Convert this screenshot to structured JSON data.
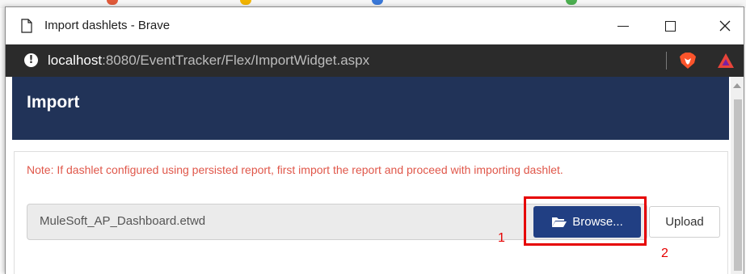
{
  "window": {
    "title": "Import dashlets - Brave"
  },
  "address_bar": {
    "url_host": "localhost",
    "url_rest": ":8080/EventTracker/Flex/ImportWidget.aspx"
  },
  "page": {
    "header_title": "Import",
    "note": "Note: If dashlet configured using persisted report, first import the report and proceed with importing dashlet.",
    "file_name": "MuleSoft_AP_Dashboard.etwd",
    "browse_label": "Browse...",
    "upload_label": "Upload"
  },
  "annotations": {
    "step1": "1",
    "step2": "2"
  },
  "icons": {
    "document": "document-icon",
    "info": "info-icon",
    "brave": "brave-lion-icon",
    "rewards": "brave-rewards-icon",
    "folder": "folder-open-icon"
  },
  "colors": {
    "header_bg": "#213358",
    "browse_bg": "#213f83",
    "note_text": "#e0574a",
    "annotation_red": "#e60000",
    "address_bar_bg": "#2b2b2b"
  }
}
